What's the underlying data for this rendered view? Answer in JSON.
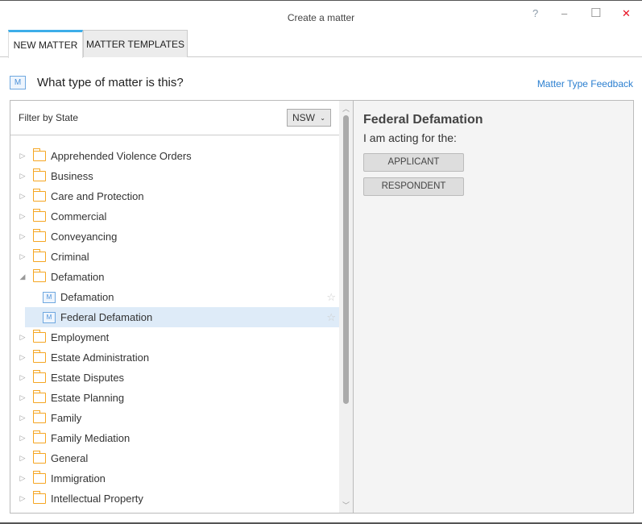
{
  "window": {
    "title": "Create a matter",
    "help": "?",
    "minimize": "–",
    "maximize": "☐",
    "close": "✕"
  },
  "tabs": [
    {
      "label": "NEW MATTER"
    },
    {
      "label": "MATTER TEMPLATES"
    }
  ],
  "heading": "What type of matter is this?",
  "feedback_link": "Matter Type Feedback",
  "filter": {
    "label": "Filter by State",
    "value": "NSW"
  },
  "tree": [
    {
      "label": "Apprehended Violence Orders"
    },
    {
      "label": "Business"
    },
    {
      "label": "Care and Protection"
    },
    {
      "label": "Commercial"
    },
    {
      "label": "Conveyancing"
    },
    {
      "label": "Criminal"
    },
    {
      "label": "Defamation",
      "expanded": true
    },
    {
      "label": "Defamation",
      "child": true
    },
    {
      "label": "Federal Defamation",
      "child": true,
      "selected": true
    },
    {
      "label": "Employment"
    },
    {
      "label": "Estate Administration"
    },
    {
      "label": "Estate Disputes"
    },
    {
      "label": "Estate Planning"
    },
    {
      "label": "Family"
    },
    {
      "label": "Family Mediation"
    },
    {
      "label": "General"
    },
    {
      "label": "Immigration"
    },
    {
      "label": "Intellectual Property"
    }
  ],
  "detail": {
    "title": "Federal Defamation",
    "subtitle": "I am acting for the:",
    "buttons": [
      "APPLICANT",
      "RESPONDENT"
    ]
  },
  "colors": {
    "accent": "#3daee9",
    "folder": "#f5a623",
    "link": "#2b7fd0",
    "selection": "#deebf8",
    "close": "#e81123"
  }
}
